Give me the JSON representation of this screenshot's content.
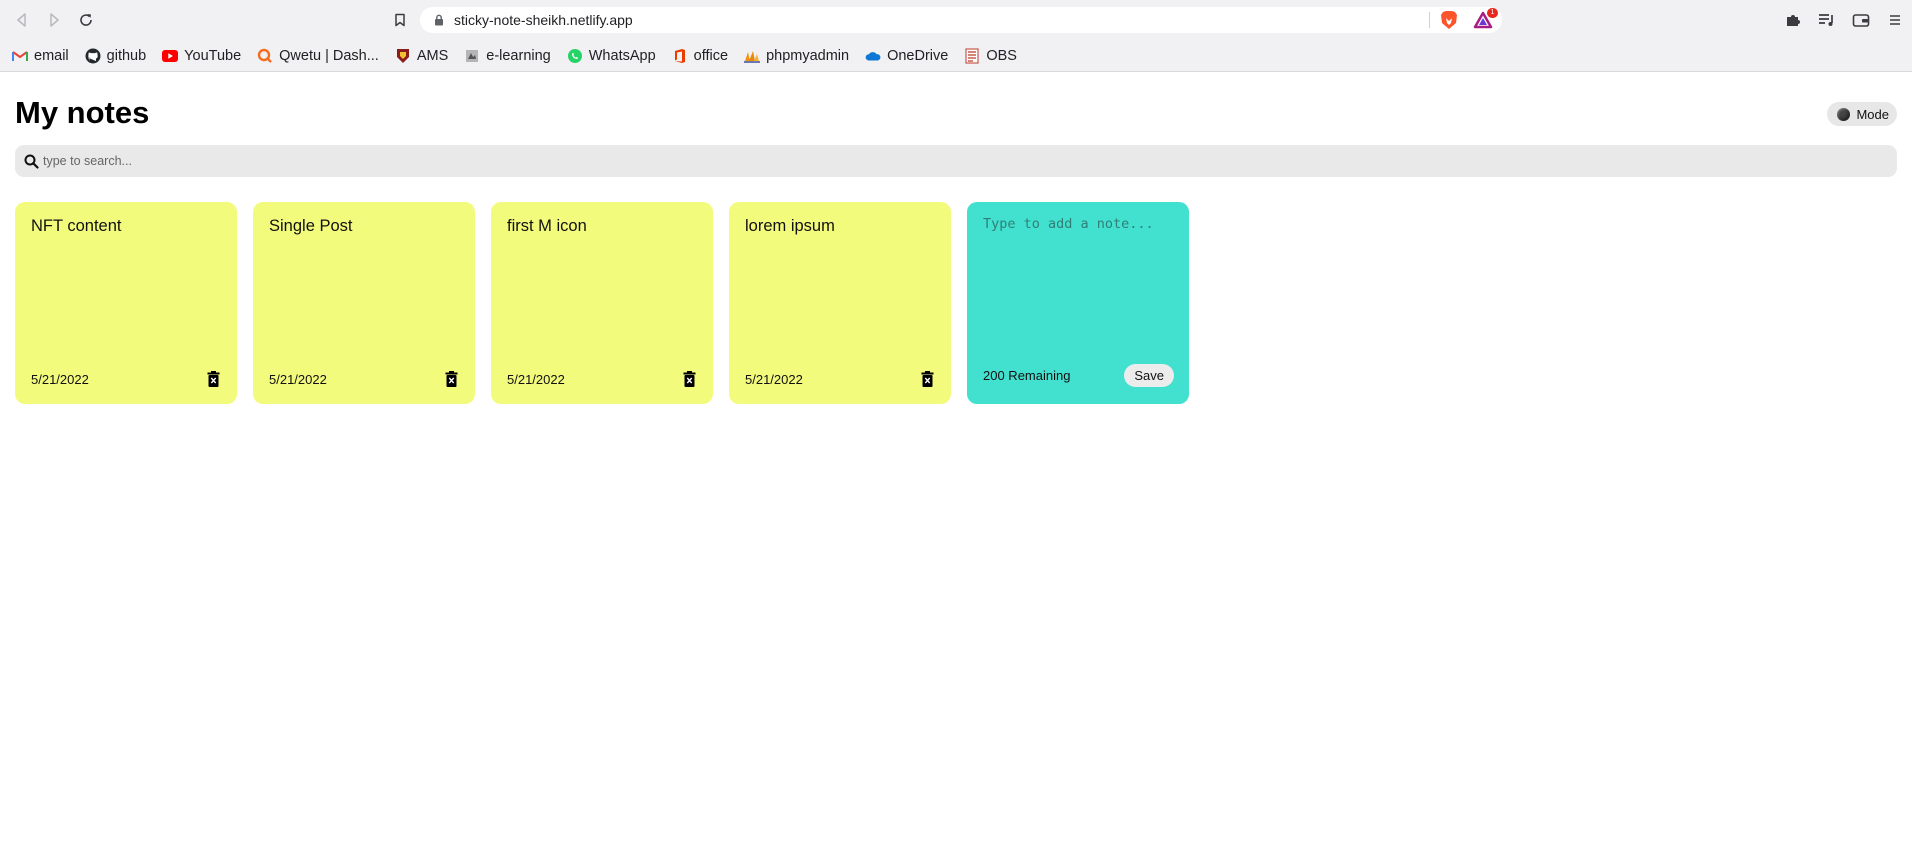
{
  "browser": {
    "url": "sticky-note-sheikh.netlify.app",
    "rewards_badge": "1",
    "bookmarks": [
      {
        "label": "email",
        "icon": "gmail-icon"
      },
      {
        "label": "github",
        "icon": "github-icon"
      },
      {
        "label": "YouTube",
        "icon": "youtube-icon"
      },
      {
        "label": "Qwetu | Dash...",
        "icon": "qwetu-icon"
      },
      {
        "label": "AMS",
        "icon": "ams-icon"
      },
      {
        "label": "e-learning",
        "icon": "elearning-icon"
      },
      {
        "label": "WhatsApp",
        "icon": "whatsapp-icon"
      },
      {
        "label": "office",
        "icon": "office-icon"
      },
      {
        "label": "phpmyadmin",
        "icon": "phpmyadmin-icon"
      },
      {
        "label": "OneDrive",
        "icon": "onedrive-icon"
      },
      {
        "label": "OBS",
        "icon": "obs-icon"
      }
    ]
  },
  "app": {
    "title": "My notes",
    "mode_label": "Mode",
    "search_placeholder": "type to search...",
    "notes": [
      {
        "text": "NFT content",
        "date": "5/21/2022"
      },
      {
        "text": "Single Post",
        "date": "5/21/2022"
      },
      {
        "text": "first M icon",
        "date": "5/21/2022"
      },
      {
        "text": "lorem ipsum",
        "date": "5/21/2022"
      }
    ],
    "new_note": {
      "placeholder": "Type to add a note...",
      "remaining": "200 Remaining",
      "save_label": "Save"
    }
  },
  "colors": {
    "note_background": "#f3fb7d",
    "new_note_background": "#41e0cf",
    "search_background": "#e9e9e9"
  }
}
